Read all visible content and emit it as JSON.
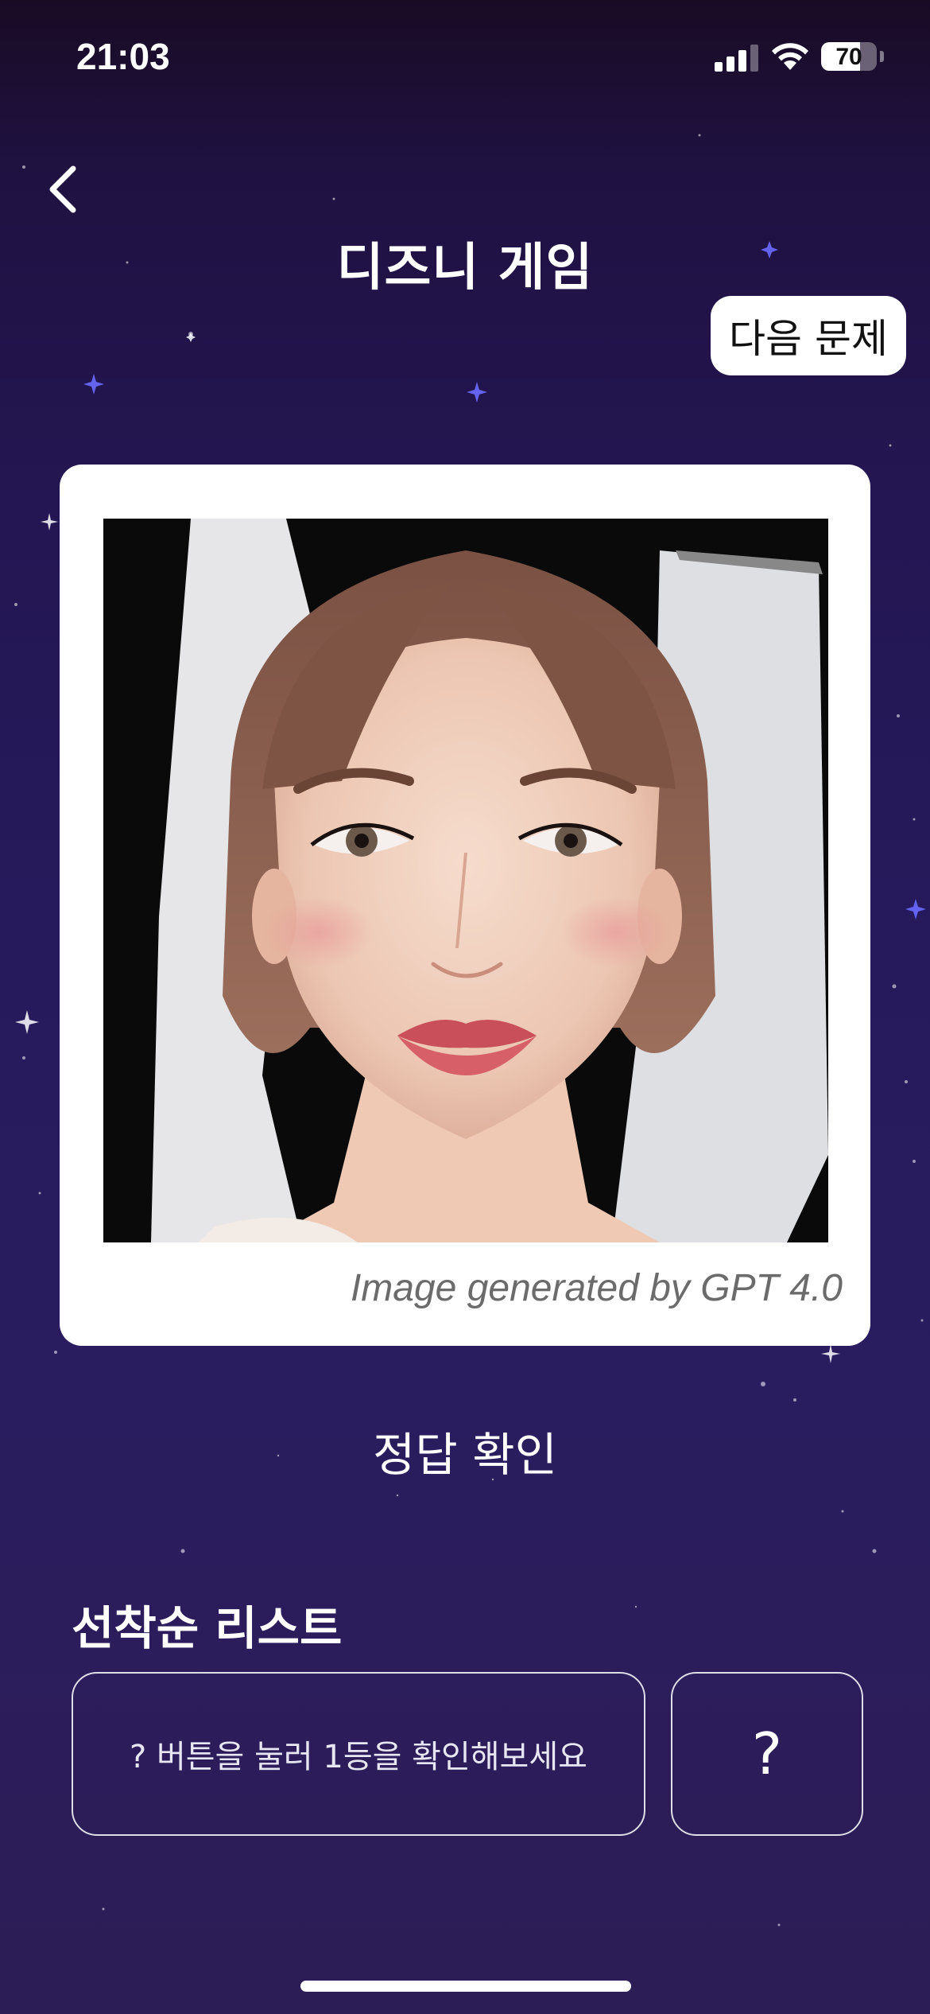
{
  "status_bar": {
    "time": "21:03",
    "battery_percent": "70",
    "battery_level": 0.7,
    "icons": [
      "cellular-signal-icon",
      "wifi-icon",
      "battery-icon"
    ]
  },
  "header": {
    "back_icon": "chevron-left-icon",
    "title": "디즈니 게임",
    "next_button": "다음 문제"
  },
  "quiz_card": {
    "image_subject": "AI-generated portrait photo",
    "caption": "Image generated by GPT 4.0"
  },
  "reveal_button": "정답 확인",
  "leaderboard": {
    "title": "선착순 리스트",
    "placeholder": "? 버튼을 눌러 1등을 확인해보세요",
    "question_button": "?"
  },
  "colors": {
    "background_top": "#190b24",
    "background_mid": "#261a5c",
    "card": "#ffffff",
    "caption_text": "#6b6b6b"
  }
}
